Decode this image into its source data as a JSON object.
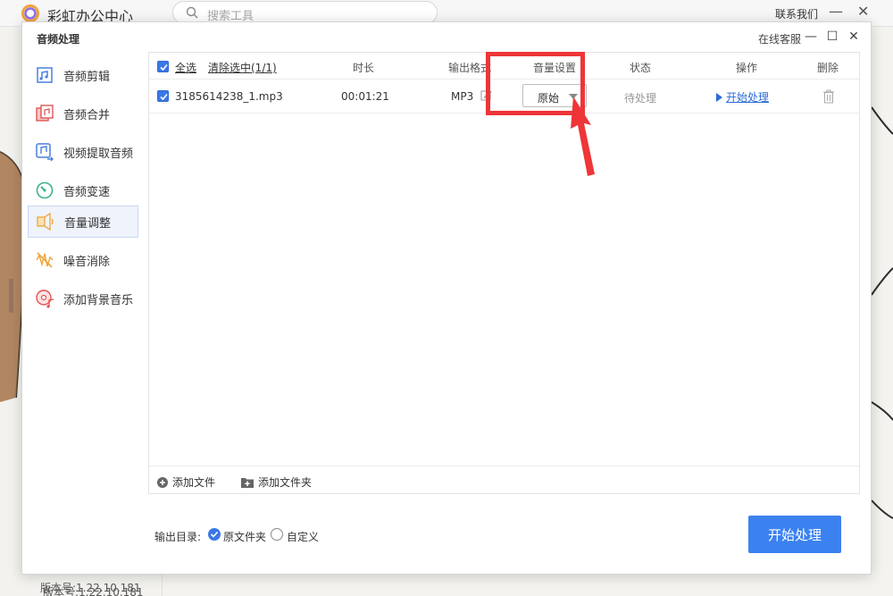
{
  "background": {
    "app_title": "彩虹办公中心",
    "search_placeholder": "搜索工具",
    "contact_label": "联系我们",
    "min_glyph": "—",
    "close_glyph": "✕",
    "version": "版本号:1.22.10.181"
  },
  "dialog": {
    "title": "音频处理",
    "service_label": "在线客服",
    "min_glyph": "—",
    "max_glyph": "☐",
    "close_glyph": "✕"
  },
  "sidebar": {
    "items": [
      {
        "label": "音频剪辑",
        "icon": "audio-cut-icon",
        "active": false
      },
      {
        "label": "音频合并",
        "icon": "audio-merge-icon",
        "active": false
      },
      {
        "label": "视频提取音频",
        "icon": "video-extract-audio-icon",
        "active": false
      },
      {
        "label": "音频变速",
        "icon": "audio-speed-icon",
        "active": false
      },
      {
        "label": "音量调整",
        "icon": "volume-adjust-icon",
        "active": true
      },
      {
        "label": "噪音消除",
        "icon": "noise-removal-icon",
        "active": false
      },
      {
        "label": "添加背景音乐",
        "icon": "add-bg-music-icon",
        "active": false
      }
    ],
    "version": "版本号:1.22.10.181"
  },
  "table": {
    "select_all": "全选",
    "clear_selected": "清除选中(1/1)",
    "columns": {
      "duration": "时长",
      "format": "输出格式",
      "volume": "音量设置",
      "status": "状态",
      "action": "操作",
      "delete": "删除"
    },
    "rows": [
      {
        "checked": true,
        "filename": "3185614238_1.mp3",
        "duration": "00:01:21",
        "format": "MP3",
        "volume": "原始",
        "status": "待处理",
        "action": "开始处理"
      }
    ]
  },
  "footer": {
    "add_file": "添加文件",
    "add_folder": "添加文件夹"
  },
  "output": {
    "label": "输出目录:",
    "options": [
      "原文件夹",
      "自定义"
    ],
    "selected": "原文件夹"
  },
  "primary_button": "开始处理",
  "colors": {
    "accent": "#3b78e7",
    "primary_button": "#3b82f0",
    "link": "#2a6ad8",
    "annotation": "#ee3538"
  }
}
